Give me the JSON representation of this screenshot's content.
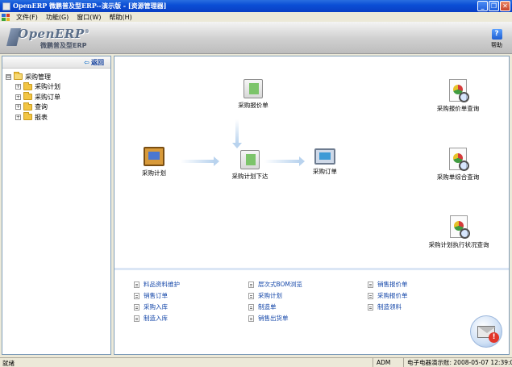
{
  "window": {
    "title": "OpenERP 微鹏普及型ERP--演示版 - [资源管理器]",
    "buttons": {
      "minimize": "_",
      "restore": "❐",
      "close": "✕"
    }
  },
  "menu": {
    "items": [
      {
        "label": "文件(F)"
      },
      {
        "label": "功能(G)"
      },
      {
        "label": "窗口(W)"
      },
      {
        "label": "帮助(H)"
      }
    ]
  },
  "banner": {
    "logo_text": "OpenERP",
    "logo_reg": "®",
    "logo_sub": "微鹏普及型ERP",
    "help_label": "帮助",
    "help_glyph": "?"
  },
  "left_panel": {
    "back_label": "返回",
    "back_glyph": "⇦",
    "tree": {
      "root": {
        "label": "采购管理",
        "expander": "⊟"
      },
      "children": [
        {
          "label": "采购计划",
          "expander": "+"
        },
        {
          "label": "采购订单",
          "expander": "+"
        },
        {
          "label": "查询",
          "expander": "+"
        },
        {
          "label": "报表",
          "expander": "+"
        }
      ]
    }
  },
  "flow": {
    "purchase_plan": "采购计划",
    "purchase_quote": "采购报价单",
    "plan_issue": "采购计划下达",
    "purchase_order": "采购订单",
    "quote_query": "采购报价单查询",
    "order_summary_query": "采购单综合查询",
    "plan_status_query": "采购计划执行状况查询"
  },
  "quick_links": [
    [
      "料品资料维护",
      "层次式BOM浏览",
      "销售报价单"
    ],
    [
      "销售订单",
      "采购计划",
      "采购报价单"
    ],
    [
      "采购入库",
      "制造单",
      "制造领料"
    ],
    [
      "制造入库",
      "销售出货单"
    ]
  ],
  "status": {
    "left": "就绪",
    "user": "ADM",
    "company": "电子电器演示账: 2008-05-07 12:39:05"
  },
  "colors": {
    "title_bar": "#0b4fd6",
    "link": "#1245a8",
    "border": "#7f9db9"
  }
}
